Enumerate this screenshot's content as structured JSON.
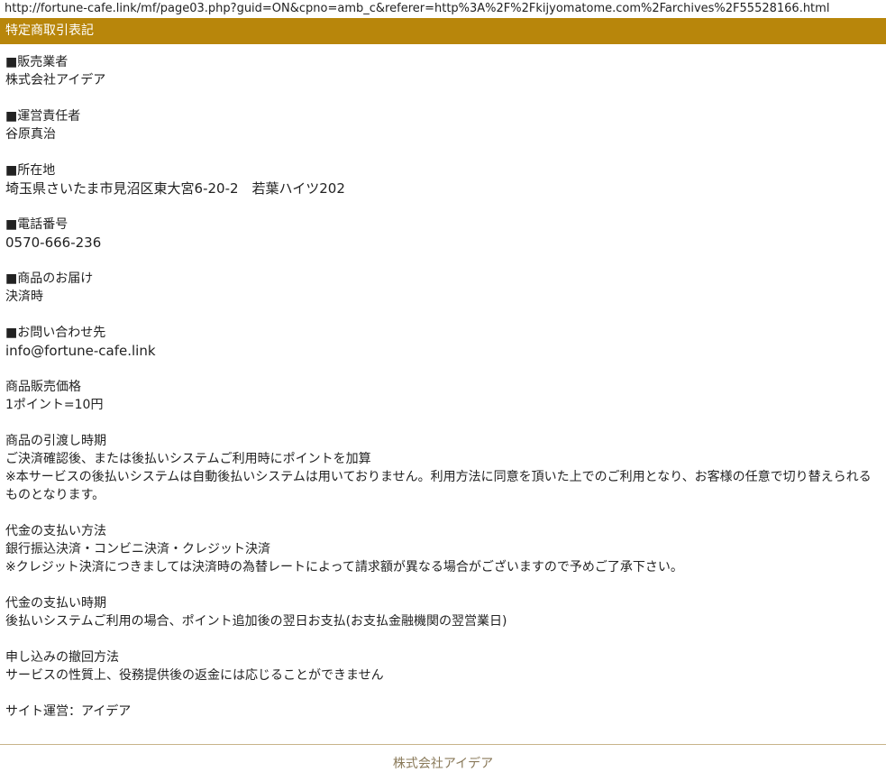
{
  "browser": {
    "url": "http://fortune-cafe.link/mf/page03.php?guid=ON&cpno=amb_c&referer=http%3A%2F%2Fkijyomatome.com%2Farchives%2F55528166.html"
  },
  "header": {
    "title": "特定商取引表記"
  },
  "sections": [
    {
      "heading": "■販売業者",
      "lines": [
        "株式会社アイデア"
      ]
    },
    {
      "heading": "■運営責任者",
      "lines": [
        "谷原真治"
      ]
    },
    {
      "heading": "■所在地",
      "lines": [
        "埼玉県さいたま市見沼区東大宮6-20-2　若葉ハイツ202"
      ]
    },
    {
      "heading": "■電話番号",
      "lines": [
        "0570-666-236"
      ]
    },
    {
      "heading": "■商品のお届け",
      "lines": [
        "決済時"
      ]
    },
    {
      "heading": "■お問い合わせ先",
      "lines": [
        "info@fortune-cafe.link"
      ]
    },
    {
      "heading": "商品販売価格",
      "lines": [
        "1ポイント=10円"
      ]
    },
    {
      "heading": "商品の引渡し時期",
      "lines": [
        "ご決済確認後、または後払いシステムご利用時にポイントを加算",
        "※本サービスの後払いシステムは自動後払いシステムは用いておりません。利用方法に同意を頂いた上でのご利用となり、お客様の任意で切り替えられるものとなります。"
      ]
    },
    {
      "heading": "代金の支払い方法",
      "lines": [
        "銀行振込決済・コンビニ決済・クレジット決済",
        "※クレジット決済につきましては決済時の為替レートによって請求額が異なる場合がございますので予めご了承下さい。"
      ]
    },
    {
      "heading": "代金の支払い時期",
      "lines": [
        "後払いシステムご利用の場合、ポイント追加後の翌日お支払(お支払金融機関の翌営業日)"
      ]
    },
    {
      "heading": "申し込みの撤回方法",
      "lines": [
        "サービスの性質上、役務提供後の返金には応じることができません"
      ]
    }
  ],
  "site_operator": "サイト運営：アイデア",
  "footer": {
    "company": "株式会社アイデア"
  },
  "colors": {
    "header_bg": "#b8860b",
    "footer_line": "#c8b48a",
    "footer_text": "#8a7a5a"
  }
}
